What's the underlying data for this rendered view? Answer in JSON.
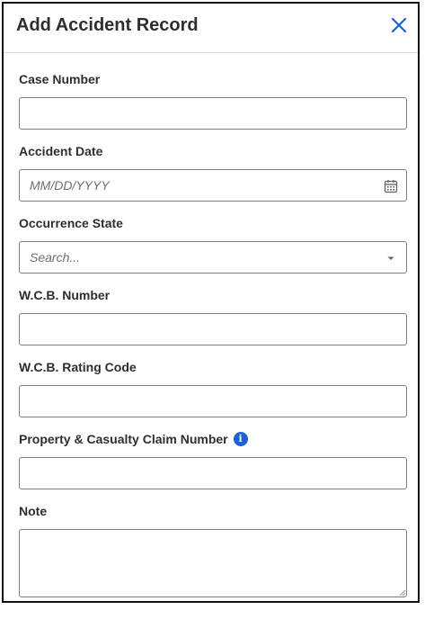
{
  "dialog": {
    "title": "Add Accident Record",
    "close_icon": "close-icon"
  },
  "fields": {
    "case_number": {
      "label": "Case Number",
      "value": "",
      "placeholder": ""
    },
    "accident_date": {
      "label": "Accident Date",
      "placeholder": "MM/DD/YYYY",
      "icon": "calendar-icon"
    },
    "occurrence_state": {
      "label": "Occurrence State",
      "placeholder": "Search...",
      "icon": "caret-down-icon"
    },
    "wcb_number": {
      "label": "W.C.B. Number",
      "value": "",
      "placeholder": ""
    },
    "wcb_rating_code": {
      "label": "W.C.B. Rating Code",
      "value": "",
      "placeholder": ""
    },
    "claim_number": {
      "label": "Property & Casualty Claim Number",
      "value": "",
      "placeholder": "",
      "info_icon": "info-icon"
    },
    "note": {
      "label": "Note",
      "value": "",
      "placeholder": ""
    }
  },
  "colors": {
    "accent": "#1f5fd6",
    "border": "#7a7f85",
    "divider": "#d6d8db"
  }
}
